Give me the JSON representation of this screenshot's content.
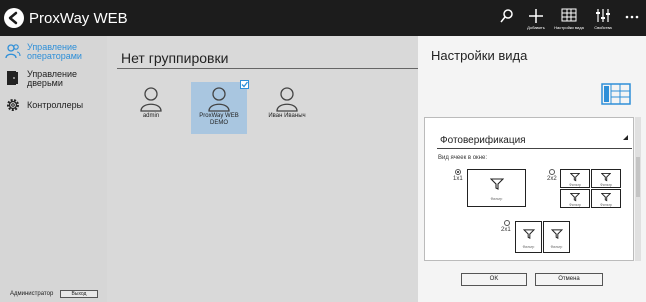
{
  "app": {
    "title": "ProxWay WEB"
  },
  "toolbar": {
    "add_label": "Добавить",
    "view_label": "Настройки вида",
    "props_label": "Свойства",
    "icons": [
      "search-icon",
      "plus-icon",
      "view-settings-icon",
      "properties-icon",
      "more-icon"
    ]
  },
  "sidebar": {
    "items": [
      {
        "label": "Управление операторами",
        "icon": "users-icon",
        "active": true
      },
      {
        "label": "Управление дверьми",
        "icon": "door-icon",
        "active": false
      },
      {
        "label": "Контроллеры",
        "icon": "gear-icon",
        "active": false
      }
    ]
  },
  "footer": {
    "user": "Администратор",
    "logout": "Выход"
  },
  "main": {
    "group_title": "Нет группировки",
    "operators": [
      {
        "name": "admin",
        "selected": false
      },
      {
        "name": "ProxWay WEB DEMO",
        "selected": true
      },
      {
        "name": "Иван Иваныч",
        "selected": false
      }
    ]
  },
  "panel": {
    "title": "Настройки вида",
    "section_title": "Фотоверификация",
    "cells_label": "Вид ячеек в окне:",
    "options": [
      {
        "label": "1x1",
        "checked": true
      },
      {
        "label": "2x2",
        "checked": false
      },
      {
        "label": "2x1",
        "checked": false
      }
    ],
    "cell_caption": "Фильтр",
    "ok_label": "OK",
    "cancel_label": "Отмена"
  },
  "colors": {
    "accent": "#2e8fd8",
    "topbar": "#1c1c1c",
    "selected": "#a9c6e0"
  }
}
